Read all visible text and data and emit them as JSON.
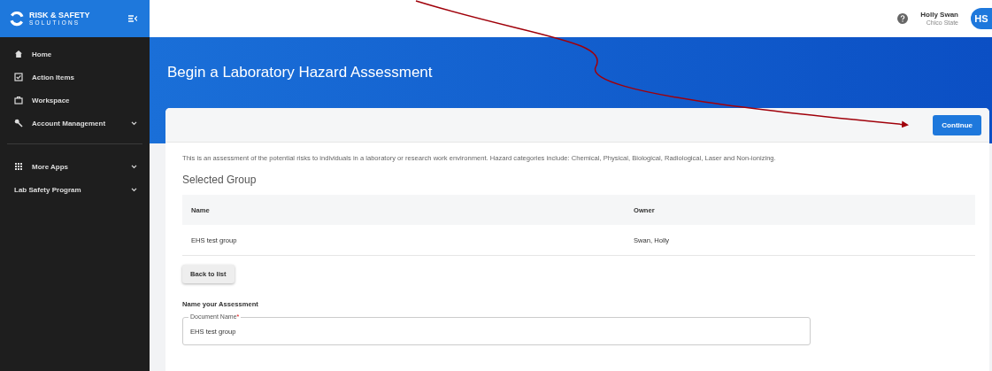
{
  "sidebar": {
    "logo": {
      "line1": "RISK & SAFETY",
      "line2": "SOLUTIONS"
    },
    "sections": [
      [
        {
          "label": "Home",
          "expandable": false
        },
        {
          "label": "Action Items",
          "expandable": false
        },
        {
          "label": "Workspace",
          "expandable": false
        },
        {
          "label": "Account Management",
          "expandable": true
        }
      ],
      [
        {
          "label": "More Apps",
          "expandable": true
        },
        {
          "label": "Lab Safety Program",
          "expandable": true
        }
      ]
    ]
  },
  "user": {
    "name": "Holly Swan",
    "org": "Chico State",
    "initials": "HS"
  },
  "page": {
    "title": "Begin a Laboratory Hazard Assessment",
    "action": "Continue",
    "description": "This is an assessment of the potential risks to individuals in a laboratory or research work environment. Hazard categories include: Chemical, Physical, Biological, Radiological, Laser and Non-ionizing.",
    "section_title": "Selected Group",
    "table": {
      "columns": [
        "Name",
        "Owner"
      ],
      "rows": [
        [
          "EHS test group",
          "Swan, Holly"
        ]
      ]
    },
    "back_button": "Back to list",
    "form_title": "Name your Assessment",
    "field": {
      "label": "Document Name",
      "required_mark": "*",
      "value": "EHS test group"
    }
  }
}
